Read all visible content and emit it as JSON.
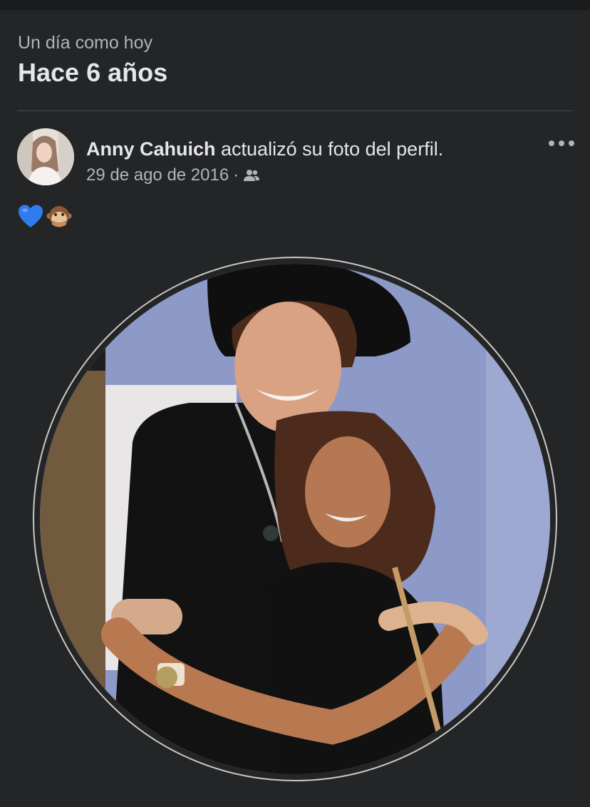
{
  "memory": {
    "subtitle": "Un día como hoy",
    "title": "Hace 6 años"
  },
  "post": {
    "author": "Anny Cahuich",
    "action": " actualizó su foto del perfil.",
    "date": "29 de ago de 2016",
    "separator": "·",
    "audience_icon": "friends-icon",
    "text_emojis": [
      "blue-heart-emoji",
      "speak-no-evil-monkey-emoji"
    ]
  },
  "colors": {
    "background": "#242526",
    "primary_text": "#e4e6eb",
    "secondary_text": "#b0b3b8",
    "photo_background": "#8f9bc7"
  }
}
